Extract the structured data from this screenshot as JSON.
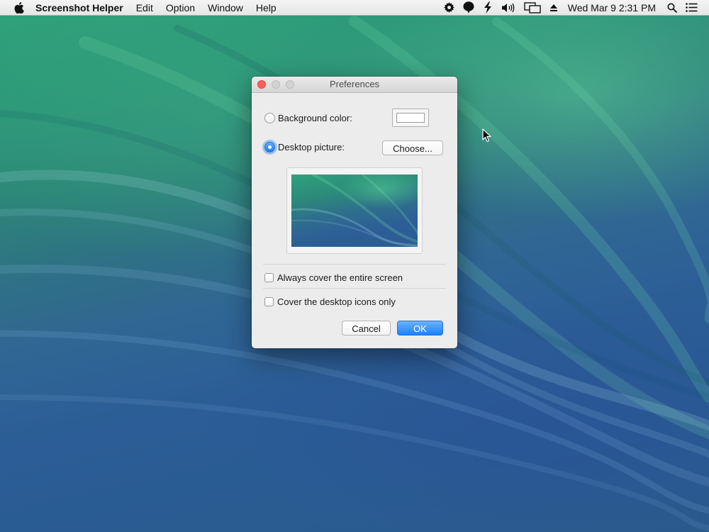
{
  "menubar": {
    "app_name": "Screenshot Helper",
    "items": [
      "Edit",
      "Option",
      "Window",
      "Help"
    ],
    "clock": "Wed Mar 9  2:31 PM",
    "status_icons": [
      "gear-icon",
      "speech-bubble-icon",
      "lightning-icon",
      "volume-icon",
      "display-mirroring-icon",
      "eject-icon",
      "spotlight-search-icon",
      "notification-center-icon"
    ]
  },
  "dialog": {
    "title": "Preferences",
    "background_color_label": "Background color:",
    "background_color_value": "#ffffff",
    "desktop_picture_label": "Desktop picture:",
    "choose_button_label": "Choose...",
    "selected_option": "desktop_picture",
    "always_cover_label": "Always cover the entire screen",
    "always_cover_checked": false,
    "cover_icons_label": "Cover the desktop icons only",
    "cover_icons_checked": false,
    "cancel_button_label": "Cancel",
    "ok_button_label": "OK"
  },
  "colors": {
    "accent_blue": "#1a82fb",
    "close_red": "#fc605c"
  }
}
